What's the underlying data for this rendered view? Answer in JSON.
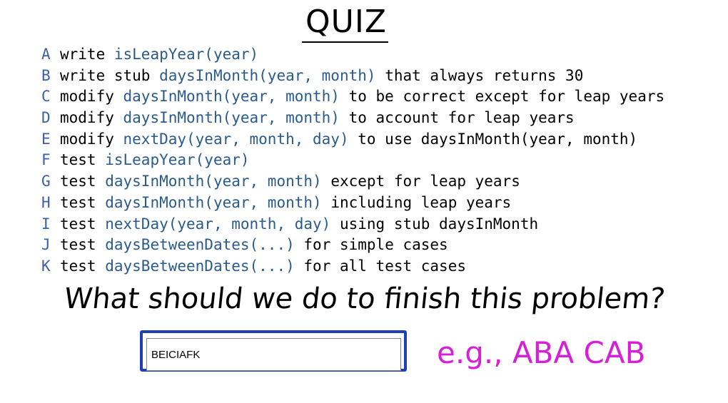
{
  "quiz": {
    "title": "QUIZ",
    "tasks": [
      {
        "letter": "A",
        "verb": "write",
        "fn": "isLeapYear(year)",
        "rest": ""
      },
      {
        "letter": "B",
        "verb": "write stub",
        "fn": "daysInMonth(year, month)",
        "rest": "that always returns 30"
      },
      {
        "letter": "C",
        "verb": "modify",
        "fn": "daysInMonth(year, month)",
        "rest": "to be correct except for leap years"
      },
      {
        "letter": "D",
        "verb": "modify",
        "fn": "daysInMonth(year, month)",
        "rest": "to account for leap years"
      },
      {
        "letter": "E",
        "verb": "modify",
        "fn": "nextDay(year, month, day)",
        "rest": "to use daysInMonth(year, month)"
      },
      {
        "letter": "F",
        "verb": "test",
        "fn": "isLeapYear(year)",
        "rest": ""
      },
      {
        "letter": "G",
        "verb": "test",
        "fn": "daysInMonth(year, month)",
        "rest": "except for leap years"
      },
      {
        "letter": "H",
        "verb": "test",
        "fn": "daysInMonth(year, month)",
        "rest": "including leap years"
      },
      {
        "letter": "I",
        "verb": "test",
        "fn": "nextDay(year, month, day)",
        "rest": "using stub daysInMonth"
      },
      {
        "letter": "J",
        "verb": "test",
        "fn": "daysBetweenDates(...)",
        "rest": "for simple cases"
      },
      {
        "letter": "K",
        "verb": "test",
        "fn": "daysBetweenDates(...)",
        "rest": "for all test cases"
      }
    ],
    "question": "What should we do to finish this problem?",
    "answer_value": "BEICIAFK",
    "example": "e.g., ABA CAB"
  },
  "colors": {
    "letter": "#3d5fa8",
    "function": "#2a5b8c",
    "answer_border": "#1f3fb6",
    "example_text": "#d61fd6"
  }
}
